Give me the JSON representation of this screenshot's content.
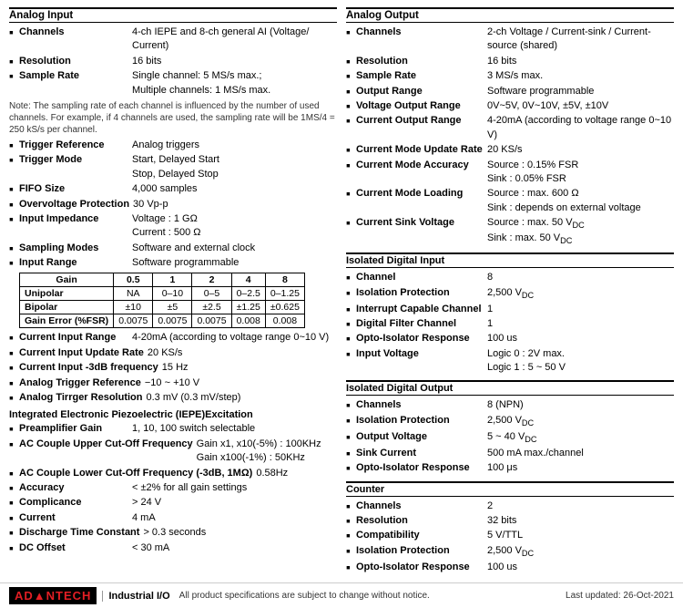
{
  "left": {
    "section_title": "Analog Input",
    "specs": [
      {
        "label": "Channels",
        "value": "4-ch IEPE and 8-ch general AI (Voltage/ Current)"
      },
      {
        "label": "Resolution",
        "value": "16 bits"
      },
      {
        "label": "Sample Rate",
        "value": "Single channel: 5 MS/s max.;\nMultiple channels: 1 MS/s max."
      }
    ],
    "note": "Note: The sampling rate of each channel is influenced by the number of used channels. For example, if 4 channels are used, the sampling rate will be 1MS/4 = 250 kS/s per channel.",
    "specs2": [
      {
        "label": "Trigger Reference",
        "value": "Analog triggers"
      },
      {
        "label": "Trigger Mode",
        "value": "Start, Delayed Start\nStop, Delayed Stop"
      },
      {
        "label": "FIFO Size",
        "value": "4,000 samples"
      },
      {
        "label": "Overvoltage Protection",
        "value": "30 Vp-p"
      },
      {
        "label": "Input Impedance",
        "value": "Voltage : 1 GΩ\nCurrent : 500 Ω"
      }
    ],
    "specs3": [
      {
        "label": "Sampling Modes",
        "value": "Software and external clock"
      },
      {
        "label": "Input Range",
        "value": "Software programmable"
      }
    ],
    "gain_table": {
      "headers": [
        "Gain",
        "0.5",
        "1",
        "2",
        "4",
        "8"
      ],
      "rows": [
        [
          "Unipolar",
          "NA",
          "0–10",
          "0–5",
          "0–2.5",
          "0–1.25"
        ],
        [
          "Bipolar",
          "±10",
          "±5",
          "±2.5",
          "±1.25",
          "±0.625"
        ],
        [
          "Gain Error (%FSR)",
          "0.0075",
          "0.0075",
          "0.0075",
          "0.008",
          "0.008"
        ]
      ]
    },
    "specs4": [
      {
        "label": "Current Input Range",
        "value": "4-20mA (according to voltage range 0~10 V)"
      },
      {
        "label": "Current Input Update Rate",
        "value": "20 KS/s"
      },
      {
        "label": "Current Input -3dB frequency",
        "value": "15 Hz"
      },
      {
        "label": "Analog Trigger Reference",
        "value": "−10 ~ +10 V"
      },
      {
        "label": "Analog Tirrger Resolution",
        "value": "0.3 mV (0.3 mV/step)"
      }
    ],
    "iepe_title": "Integrated Electronic Piezoelectric (IEPE)Excitation",
    "iepe_specs": [
      {
        "label": "Preamplifier Gain",
        "value": "1, 10, 100 switch selectable"
      },
      {
        "label": "AC Couple Upper Cut-Off Frequency",
        "value": "Gain x1, x10(-5%) : 100KHz\nGain x100(-1%) : 50KHz"
      },
      {
        "label": "AC Couple Lower Cut-Off Frequency (-3dB, 1MΩ)",
        "value": "0.58Hz"
      },
      {
        "label": "Accuracy",
        "value": "< ±2% for all gain settings"
      },
      {
        "label": "Complicance",
        "value": "> 24 V"
      },
      {
        "label": "Current",
        "value": "4 mA"
      },
      {
        "label": "Discharge Time Constant",
        "value": "> 0.3 seconds"
      },
      {
        "label": "DC Offset",
        "value": "< 30 mA"
      }
    ]
  },
  "right": {
    "section_title": "Analog Output",
    "specs": [
      {
        "label": "Channels",
        "value": "2-ch Voltage / Current-sink / Current-source (shared)"
      },
      {
        "label": "Resolution",
        "value": "16 bits"
      },
      {
        "label": "Sample Rate",
        "value": "3 MS/s max."
      },
      {
        "label": "Output Range",
        "value": "Software programmable"
      },
      {
        "label": "Voltage Output Range",
        "value": "0V~5V, 0V~10V, ±5V, ±10V"
      },
      {
        "label": "Current Output Range",
        "value": "4-20mA (according to voltage range 0~10 V)"
      },
      {
        "label": "Current Mode Update Rate",
        "value": "20 KS/s"
      },
      {
        "label": "Current Mode Accuracy",
        "value": "Source : 0.15% FSR\nSink : 0.05% FSR"
      },
      {
        "label": "Current Mode Loading",
        "value": "Source : max. 600 Ω\nSink : depends on external voltage"
      },
      {
        "label": "Current Sink Voltage",
        "value": "Source : max. 50 V DC\nSink : max. 50 V DC"
      }
    ],
    "isolated_digital_input_title": "Isolated Digital Input",
    "isolated_digital_input": [
      {
        "label": "Channel",
        "value": "8"
      },
      {
        "label": "Isolation Protection",
        "value": "2,500 V DC"
      },
      {
        "label": "Interrupt Capable Channel",
        "value": "1"
      },
      {
        "label": "Digital Filter Channel",
        "value": "1"
      },
      {
        "label": "Opto-Isolator Response",
        "value": "100 us"
      },
      {
        "label": "Input Voltage",
        "value": "Logic 0 : 2V max.\nLogic 1 : 5 ~ 50 V"
      }
    ],
    "isolated_digital_output_title": "Isolated Digital Output",
    "isolated_digital_output": [
      {
        "label": "Channels",
        "value": "8 (NPN)"
      },
      {
        "label": "Isolation Protection",
        "value": "2,500 V DC"
      },
      {
        "label": "Output Voltage",
        "value": "5 ~ 40 V DC"
      },
      {
        "label": "Sink Current",
        "value": "500 mA max./channel"
      },
      {
        "label": "Opto-Isolator Response",
        "value": "100 μs"
      }
    ],
    "counter_title": "Counter",
    "counter": [
      {
        "label": "Channels",
        "value": "2"
      },
      {
        "label": "Resolution",
        "value": "32 bits"
      },
      {
        "label": "Compatibility",
        "value": "5 V/TTL"
      },
      {
        "label": "Isolation Protection",
        "value": "2,500 V DC"
      },
      {
        "label": "Opto-Isolator Response",
        "value": "100 us"
      }
    ]
  },
  "footer": {
    "brand_logo": "ADᴀNTECH",
    "brand_section": "Industrial I/O",
    "note": "All product specifications are subject to change without notice.",
    "date": "Last updated: 26-Oct-2021"
  }
}
